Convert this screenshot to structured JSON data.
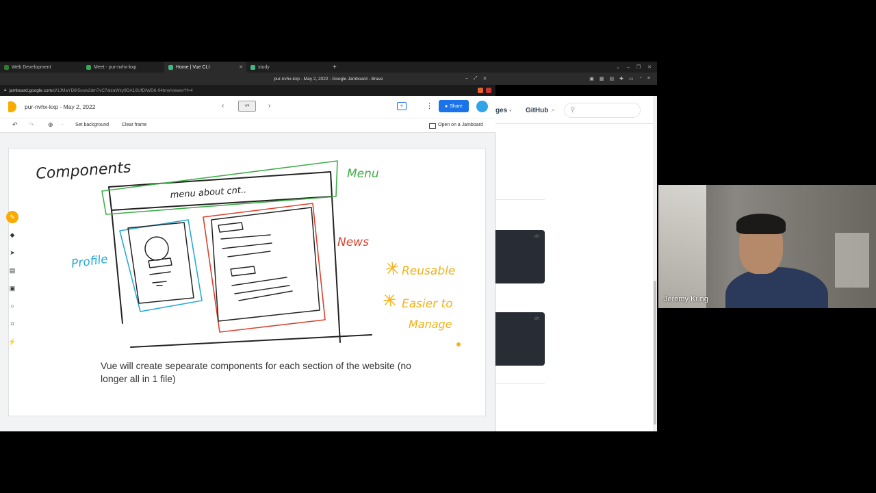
{
  "browser": {
    "tabs": [
      {
        "label": "Web Development",
        "color": "#2e7d32"
      },
      {
        "label": "Meet - pur-nvhx-kxp",
        "color": "#34a853"
      },
      {
        "label": "Home | Vue CLI",
        "color": "#41b883"
      },
      {
        "label": "study",
        "color": "#41b883"
      }
    ],
    "new_tab": "+",
    "window_title": "pur-nvhx-kxp - May 2, 2022 - Google Jamboard - Brave",
    "url_domain": "jamboard.google.com",
    "url_path": "/d/1JMaYD8I5osw2dm7vC7alzaWzy9DA19UfDIWD6-04brw/viewer?f=4"
  },
  "jamboard": {
    "title": "pur-nvhx-kxp - May 2, 2022",
    "frame_indicator": "4/4",
    "share_label": "Share",
    "toolbar": {
      "set_background": "Set background",
      "clear_frame": "Clear frame",
      "open_on_jamboard": "Open on a Jamboard",
      "zoom_dropdown": "-"
    },
    "tools": [
      "pen-icon",
      "eraser-icon",
      "select-icon",
      "sticky-note-icon",
      "image-icon",
      "circle-icon",
      "text-box-icon",
      "laser-icon"
    ],
    "canvas": {
      "caption": "Vue will create sepearate components for each section of the website (no longer all in 1 file)",
      "handwriting": {
        "components": "Components",
        "menu_bar_text": "menu about cnt..",
        "menu": "Menu",
        "profile": "Profile",
        "news": "News",
        "reusable": "Reusable",
        "easier": "Easier to",
        "manage": "Manage"
      },
      "colors": {
        "black": "#222222",
        "green": "#3fae49",
        "red": "#d9412b",
        "blue": "#27a9d9",
        "yellow": "#f2b21b"
      }
    }
  },
  "vue_page": {
    "nav_partial": "ges",
    "nav_github": "GitHub",
    "code_tag": "sh"
  },
  "video": {
    "participant_name": "Jeremy Kung"
  }
}
